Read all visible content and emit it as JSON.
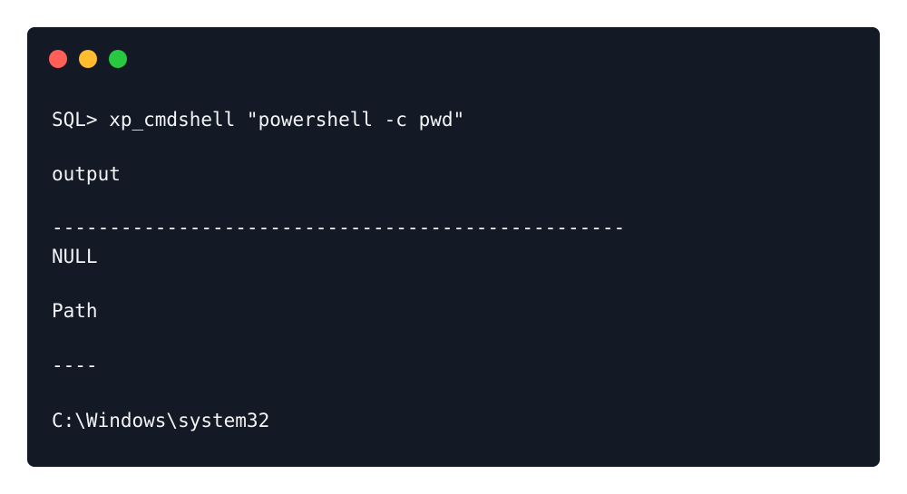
{
  "window": {
    "controls": [
      {
        "name": "close",
        "color": "#ff5f57"
      },
      {
        "name": "minimize",
        "color": "#febc2e"
      },
      {
        "name": "maximize",
        "color": "#28c840"
      }
    ],
    "background": "#131a26"
  },
  "terminal": {
    "lines": [
      "SQL> xp_cmdshell \"powershell -c pwd\"",
      "output",
      "--------------------------------------------------",
      "NULL",
      "Path",
      "----",
      "C:\\Windows\\system32"
    ]
  }
}
